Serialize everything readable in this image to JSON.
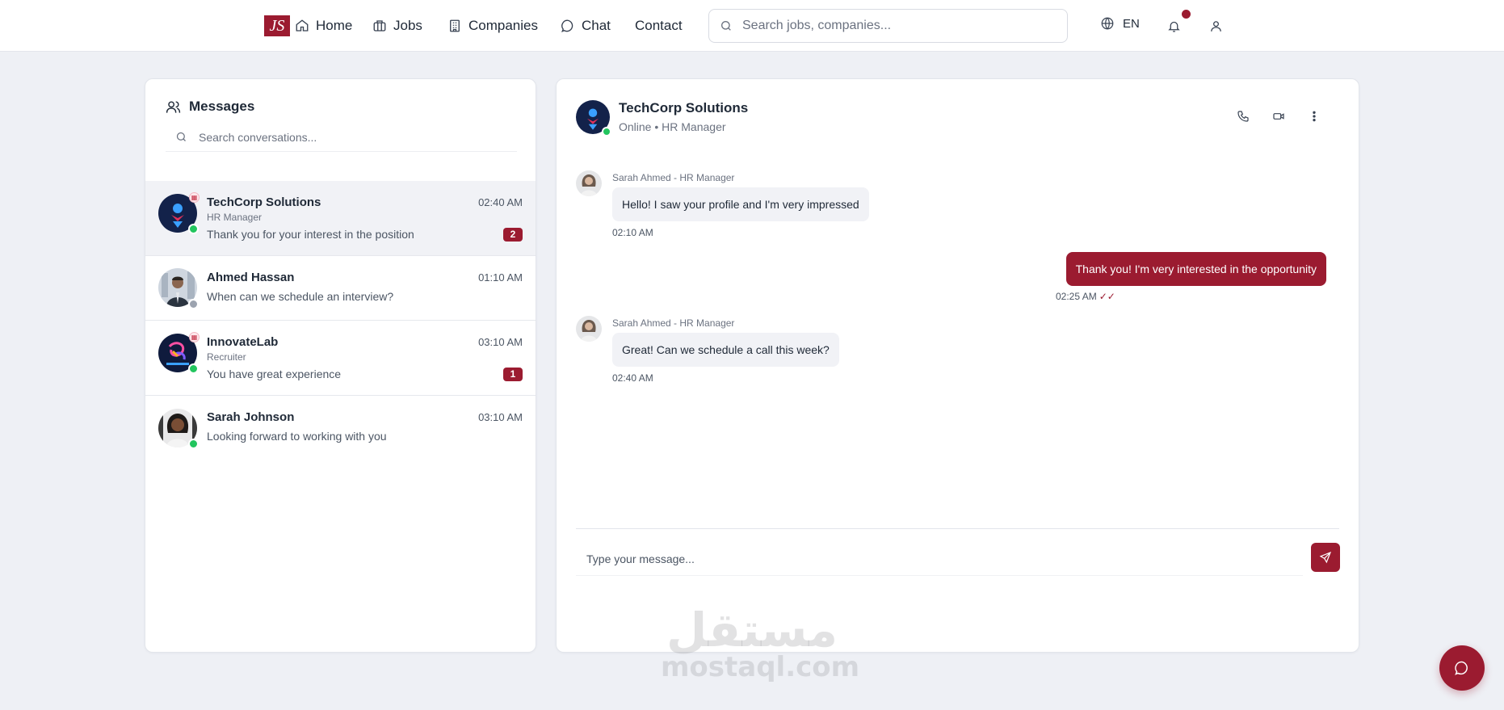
{
  "nav": {
    "logo_text": "JS",
    "items": [
      {
        "label": "Home",
        "icon": "home-icon"
      },
      {
        "label": "Jobs",
        "icon": "briefcase-icon"
      },
      {
        "label": "Companies",
        "icon": "building-icon"
      },
      {
        "label": "Chat",
        "icon": "chat-icon"
      },
      {
        "label": "Contact",
        "icon": ""
      }
    ],
    "search_placeholder": "Search jobs, companies...",
    "language": "EN",
    "notification_dot": true,
    "icons": [
      "globe-icon",
      "bell-icon",
      "user-icon"
    ]
  },
  "sidebar": {
    "title": "Messages",
    "search_placeholder": "Search conversations...",
    "conversations": [
      {
        "name": "TechCorp Solutions",
        "role": "HR Manager",
        "time": "02:40 AM",
        "preview": "Thank you for your interest in the position",
        "unread": "2",
        "online": true,
        "company": true,
        "active": true
      },
      {
        "name": "Ahmed Hassan",
        "role": "",
        "time": "01:10 AM",
        "preview": "When can we schedule an interview?",
        "unread": "",
        "online": false,
        "company": false,
        "active": false
      },
      {
        "name": "InnovateLab",
        "role": "Recruiter",
        "time": "03:10 AM",
        "preview": "You have great experience",
        "unread": "1",
        "online": true,
        "company": true,
        "active": false
      },
      {
        "name": "Sarah Johnson",
        "role": "",
        "time": "03:10 AM",
        "preview": "Looking forward to working with you",
        "unread": "",
        "online": true,
        "company": false,
        "active": false
      }
    ]
  },
  "chat": {
    "name": "TechCorp Solutions",
    "subtitle": "Online • HR Manager",
    "actions": [
      "phone-icon",
      "video-icon",
      "more-vertical-icon"
    ],
    "messages": [
      {
        "direction": "in",
        "sender": "Sarah Ahmed - HR Manager",
        "text": "Hello! I saw your profile and I'm very impressed",
        "time": "02:10 AM"
      },
      {
        "direction": "out",
        "sender": "",
        "text": "Thank you! I'm very interested in the opportunity",
        "time": "02:25 AM",
        "read_mark": "✓✓"
      },
      {
        "direction": "in",
        "sender": "Sarah Ahmed - HR Manager",
        "text": "Great! Can we schedule a call this week?",
        "time": "02:40 AM"
      }
    ],
    "composer_placeholder": "Type your message..."
  },
  "watermark": {
    "arabic": "مستقل",
    "latin": "mostaql.com"
  },
  "colors": {
    "brand": "#9b1b30",
    "online": "#22c55e",
    "offline": "#9ca3af",
    "background": "#eef0f5"
  }
}
